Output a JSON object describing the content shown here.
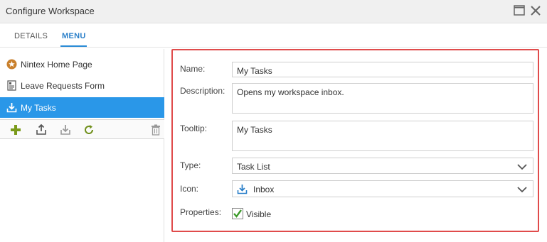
{
  "window": {
    "title": "Configure Workspace",
    "maximize_icon": "maximize-icon",
    "close_icon": "close-icon"
  },
  "tabs": [
    {
      "label": "DETAILS",
      "active": false
    },
    {
      "label": "MENU",
      "active": true
    }
  ],
  "sidebar": {
    "items": [
      {
        "label": "Nintex Home Page",
        "icon": "star-badge-icon",
        "selected": false
      },
      {
        "label": "Leave Requests Form",
        "icon": "form-icon",
        "selected": false
      },
      {
        "label": "My Tasks",
        "icon": "inbox-download-icon",
        "selected": true
      }
    ],
    "toolbar": [
      "add-icon",
      "move-up-icon",
      "move-down-icon",
      "refresh-icon",
      "delete-icon"
    ]
  },
  "form": {
    "name_label": "Name:",
    "name_value": "My Tasks",
    "description_label": "Description:",
    "description_value": "Opens my workspace inbox.",
    "tooltip_label": "Tooltip:",
    "tooltip_value": "My Tasks",
    "type_label": "Type:",
    "type_value": "Task List",
    "icon_label": "Icon:",
    "icon_value": "Inbox",
    "properties_label": "Properties:",
    "visible_label": "Visible",
    "visible_checked": true
  },
  "colors": {
    "accent": "#2a97e8",
    "highlight_border": "#e04b4b",
    "add_green": "#7a9a1a"
  }
}
